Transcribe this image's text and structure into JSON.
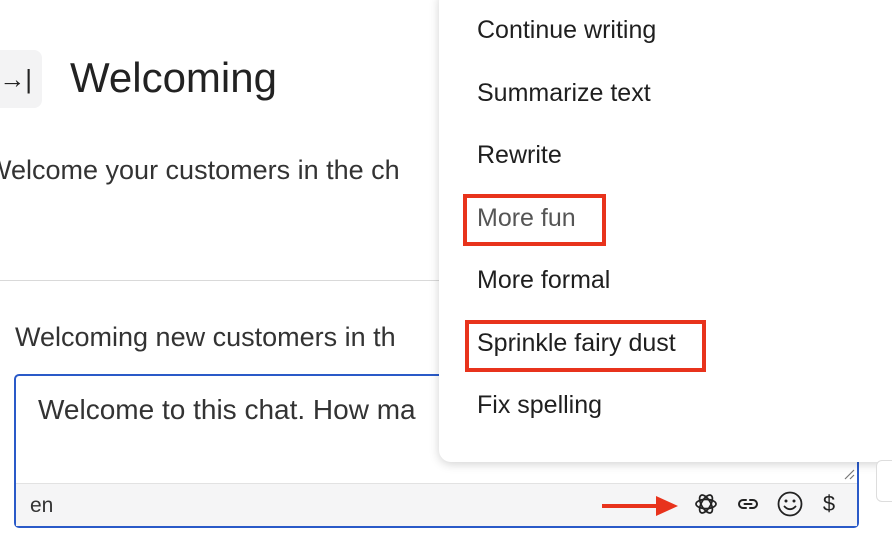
{
  "header": {
    "collapse_icon": "→|",
    "title": "Welcoming",
    "description": "Welcome your customers in the ch"
  },
  "form": {
    "field_label": "Welcoming new customers in th",
    "editor_text": "Welcome to this chat. How ma",
    "language": "en",
    "toolbar": {
      "ai_icon": "openai-icon",
      "link_icon": "link-icon",
      "emoji_icon": "smiley-icon",
      "dollar_label": "$"
    }
  },
  "ai_menu": {
    "items": [
      {
        "label": "Continue writing"
      },
      {
        "label": "Summarize text"
      },
      {
        "label": "Rewrite"
      },
      {
        "label": "More fun",
        "highlighted": true
      },
      {
        "label": "More formal"
      },
      {
        "label": "Sprinkle fairy dust",
        "highlighted": true
      },
      {
        "label": "Fix spelling"
      }
    ]
  },
  "annotations": {
    "highlight_color": "#e8331c",
    "editor_border_color": "#2a5ac8"
  }
}
